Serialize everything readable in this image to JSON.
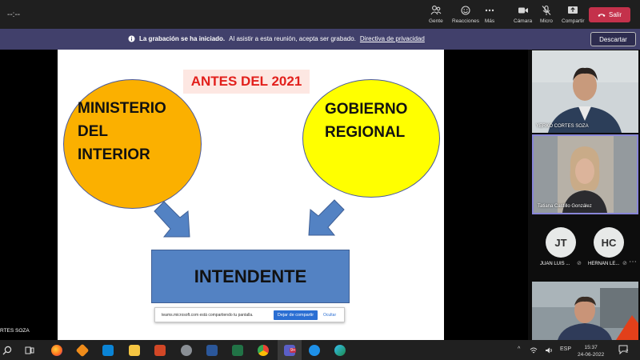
{
  "meeting": {
    "timer": "--:--"
  },
  "toolbar": {
    "people_label": "Gente",
    "reactions_label": "Reacciones",
    "more_label": "Más",
    "camera_label": "Cámara",
    "mic_label": "Micro",
    "share_label": "Compartir",
    "leave_label": "Salir"
  },
  "banner": {
    "title": "La grabación se ha iniciado.",
    "message": "Al asistir a esta reunión, acepta ser grabado.",
    "link": "Directiva de privacidad",
    "dismiss_label": "Descartar"
  },
  "slide": {
    "year_label": "ANTES DEL 2021",
    "left_circle": [
      "MINISTERIO",
      "DEL",
      "INTERIOR"
    ],
    "right_circle": [
      "GOBIERNO",
      "REGIONAL"
    ],
    "box_label": "INTENDENTE",
    "colors": {
      "left_circle": "#fbb000",
      "right_circle": "#ffff00",
      "box": "#5382c3",
      "arrow": "#5382c3",
      "year_text": "#e2201c"
    }
  },
  "sharebar": {
    "text": "teams.microsoft.com está compartiendo tu pantalla.",
    "stop_label": "Dejar de compartir",
    "hide_label": "Ocultar"
  },
  "presenter_name": "RTES SOZA",
  "participants": {
    "video1_name": "YERKO CORTES SOZA",
    "video2_name": "Tatiana Castillo González",
    "avatar1_initials": "JT",
    "avatar1_name": "JUAN LUIS ...",
    "avatar2_initials": "HC",
    "avatar2_name": "HERNAN LE..."
  },
  "taskbar": {
    "teams_badge": "9+",
    "language": "ESP",
    "time": "15:37",
    "date": "24-06-2022",
    "notification_count": "2"
  }
}
